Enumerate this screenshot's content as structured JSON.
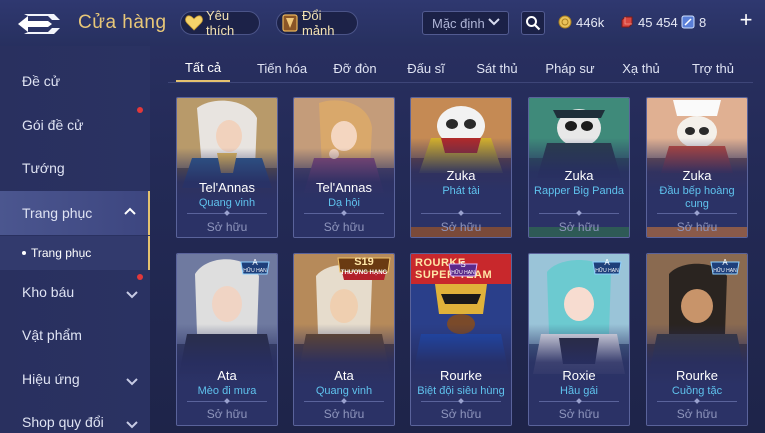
{
  "header": {
    "title": "Cửa hàng",
    "favorite_label": "Yêu thích",
    "exchange_label": "Đổi mảnh",
    "sort_value": "Mặc định",
    "currencies": [
      {
        "icon": "gold-coin-icon",
        "value": "446k"
      },
      {
        "icon": "ruby-icon",
        "value": "45 454"
      },
      {
        "icon": "voucher-icon",
        "value": "8"
      }
    ],
    "add_symbol": "+"
  },
  "sidebar": {
    "items": [
      {
        "label": "Đề cử"
      },
      {
        "label": "Gói đề cử"
      },
      {
        "label": "Tướng"
      },
      {
        "label": "Trang phục"
      },
      {
        "label": "Trang phục"
      },
      {
        "label": "Kho báu"
      },
      {
        "label": "Vật phẩm"
      },
      {
        "label": "Hiệu ứng"
      },
      {
        "label": "Shop quy đổi"
      }
    ]
  },
  "tabs": [
    {
      "label": "Tất cả"
    },
    {
      "label": "Tiến hóa"
    },
    {
      "label": "Đỡ đòn"
    },
    {
      "label": "Đấu sĩ"
    },
    {
      "label": "Sát thủ"
    },
    {
      "label": "Pháp sư"
    },
    {
      "label": "Xạ thủ"
    },
    {
      "label": "Trợ thủ"
    }
  ],
  "cards": [
    {
      "hero": "Tel'Annas",
      "skin": "Quang vinh",
      "status": "Sở hữu"
    },
    {
      "hero": "Tel'Annas",
      "skin": "Dạ hội",
      "status": "Sở hữu"
    },
    {
      "hero": "Zuka",
      "skin": "Phát tài",
      "status": "Sở hữu"
    },
    {
      "hero": "Zuka",
      "skin": "Rapper Big Panda",
      "status": "Sở hữu"
    },
    {
      "hero": "Zuka",
      "skin": "Đầu bếp hoàng cung",
      "status": "Sở hữu"
    },
    {
      "hero": "Ata",
      "skin": "Mèo đi mưa",
      "status": "Sở hữu",
      "badge": "A",
      "badge_sub": "HỮU HẠN"
    },
    {
      "hero": "Ata",
      "skin": "Quang vinh",
      "status": "Sở hữu",
      "badge": "S19",
      "badge_sub": "THƯỢNG HẠNG"
    },
    {
      "hero": "Rourke",
      "skin": "Biệt đội siêu hùng",
      "status": "Sở hữu",
      "badge": "S",
      "badge_sub": "HỮU HẠN",
      "art_text": "ROURKE SUPER TEAM"
    },
    {
      "hero": "Roxie",
      "skin": "Hầu gái",
      "status": "Sở hữu",
      "badge": "A",
      "badge_sub": "HỮU HẠN"
    },
    {
      "hero": "Rourke",
      "skin": "Cuồng tặc",
      "status": "Sở hữu",
      "badge": "A",
      "badge_sub": "HỮU HẠN"
    }
  ],
  "colors": {
    "accent_gold": "#e4c26f",
    "skin_name_blue": "#5fc3ee",
    "notification_red": "#e2383a"
  }
}
